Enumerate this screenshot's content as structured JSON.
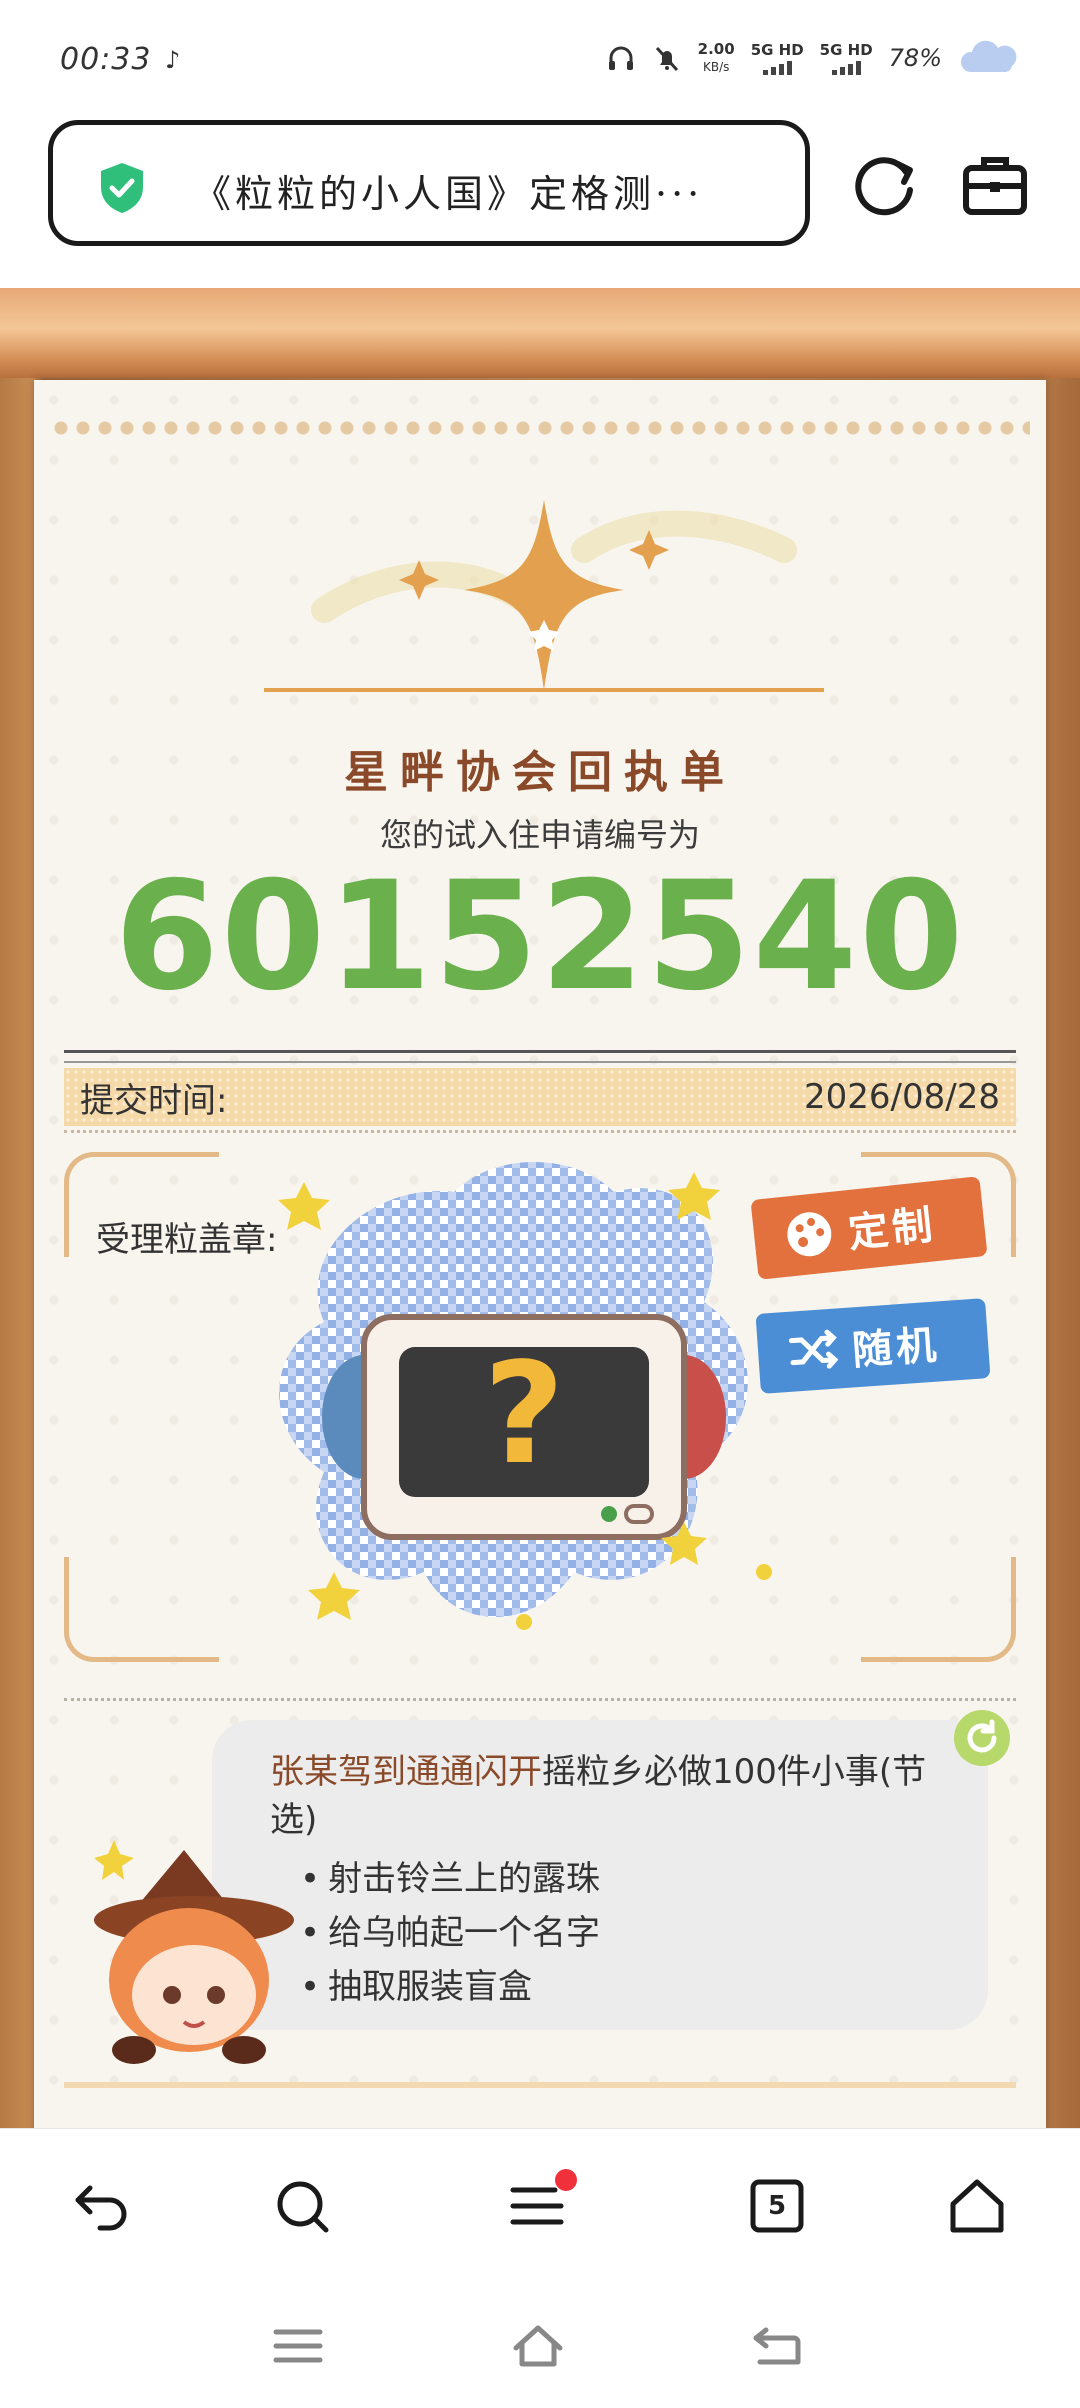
{
  "status_bar": {
    "time": "00:33",
    "net_speed": "2.00",
    "net_unit": "KB/s",
    "sim1": "5G HD",
    "sim2": "5G HD",
    "battery": "78%"
  },
  "url_bar": {
    "title": "《粒粒的小人国》定格测···"
  },
  "receipt": {
    "title": "星畔协会回执单",
    "prompt": "您的试入住申请编号为",
    "number": "60152540",
    "submit_label": "提交时间:",
    "submit_date": "2026/08/28",
    "stamp_label": "受理粒盖章:",
    "custom_button": "定制",
    "random_button": "随机"
  },
  "tips": {
    "highlight": "张某驾到通通闪开",
    "text": "摇粒乡必做100件小事(节选)",
    "items": [
      "射击铃兰上的露珠",
      "给乌帕起一个名字",
      "抽取服装盲盒"
    ]
  },
  "browser_nav": {
    "tab_count": "5"
  },
  "colors": {
    "number_green": "#6ab04c",
    "title_brown": "#8a4a2a",
    "custom_orange": "#e2713e",
    "random_blue": "#4b8ed6",
    "badge_red": "#f0303a"
  }
}
